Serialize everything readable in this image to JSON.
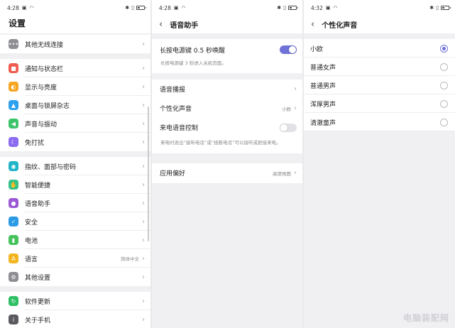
{
  "colors": {
    "accent": "#6f72d6",
    "bg": "#f0f0f3"
  },
  "settings": {
    "time": "4:28",
    "title": "设置",
    "groups": [
      [
        {
          "label": "其他无线连接",
          "icon": "more-dots-icon",
          "color": "#8e8e93",
          "glyph": "•••"
        }
      ],
      [
        {
          "label": "通知与状态栏",
          "icon": "notification-icon",
          "color": "#f05b4e",
          "glyph": "■"
        },
        {
          "label": "显示与亮度",
          "icon": "brightness-icon",
          "color": "#f5a623",
          "glyph": "◐"
        },
        {
          "label": "桌面与锁屏杂志",
          "icon": "wallpaper-icon",
          "color": "#2fa0ef",
          "glyph": "▲"
        },
        {
          "label": "声音与振动",
          "icon": "sound-icon",
          "color": "#3dc46a",
          "glyph": "◀"
        },
        {
          "label": "免打扰",
          "icon": "moon-icon",
          "color": "#8b6cf0",
          "glyph": "☾"
        }
      ],
      [
        {
          "label": "指纹、面部与密码",
          "icon": "fingerprint-icon",
          "color": "#20b4c9",
          "glyph": "◉"
        },
        {
          "label": "智能便捷",
          "icon": "smart-icon",
          "color": "#35c48a",
          "glyph": "✋"
        },
        {
          "label": "语音助手",
          "icon": "microphone-icon",
          "color": "#9b59d6",
          "glyph": "●"
        },
        {
          "label": "安全",
          "icon": "shield-icon",
          "color": "#2c9be5",
          "glyph": "✓"
        },
        {
          "label": "电池",
          "icon": "battery-icon",
          "color": "#45c25c",
          "glyph": "▮"
        },
        {
          "label": "语言",
          "icon": "language-icon",
          "color": "#f3b51f",
          "glyph": "A",
          "value": "简体中文"
        },
        {
          "label": "其他设置",
          "icon": "gear-icon",
          "color": "#8e8e93",
          "glyph": "⚙"
        }
      ],
      [
        {
          "label": "软件更新",
          "icon": "update-icon",
          "color": "#2fbf64",
          "glyph": "↻"
        },
        {
          "label": "关于手机",
          "icon": "info-icon",
          "color": "#5a5a60",
          "glyph": "i"
        }
      ]
    ]
  },
  "voice": {
    "time": "4:28",
    "title": "语音助手",
    "power_wake_label": "长按电源键 0.5 秒唤醒",
    "power_wake_on": true,
    "power_wake_desc": "长按电源键 3 秒进入关机页面。",
    "broadcast_label": "语音播报",
    "voice_label": "个性化声音",
    "voice_value": "小欧",
    "call_control_label": "来电语音控制",
    "call_control_on": false,
    "call_control_desc": "来电时说出“接听电话”或“挂断电话”可以接听或拒接来电。",
    "app_pref_label": "应用偏好",
    "app_pref_value": "高德地图"
  },
  "personal": {
    "time": "4:32",
    "title": "个性化声音",
    "options": [
      {
        "label": "小欧",
        "selected": true
      },
      {
        "label": "普通女声",
        "selected": false
      },
      {
        "label": "普通男声",
        "selected": false
      },
      {
        "label": "浑厚男声",
        "selected": false
      },
      {
        "label": "清澈童声",
        "selected": false
      }
    ]
  },
  "watermark": "电脑装配网"
}
